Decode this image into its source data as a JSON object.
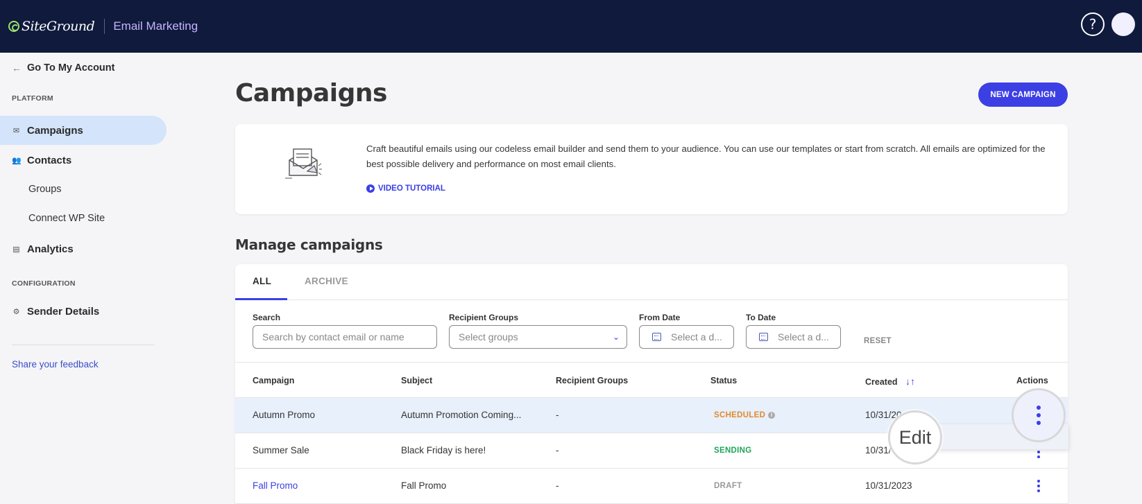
{
  "header": {
    "brand": "SiteGround",
    "product": "Email Marketing",
    "help_glyph": "?"
  },
  "sidebar": {
    "back_label": "Go To My Account",
    "platform_label": "PLATFORM",
    "configuration_label": "CONFIGURATION",
    "items": [
      {
        "label": "Campaigns",
        "icon": "mail-icon",
        "active": true
      },
      {
        "label": "Contacts",
        "icon": "users-icon"
      },
      {
        "label": "Groups"
      },
      {
        "label": "Connect WP Site"
      },
      {
        "label": "Analytics",
        "icon": "chart-icon"
      },
      {
        "label": "Sender Details",
        "icon": "gear-icon"
      }
    ],
    "feedback": "Share your feedback"
  },
  "main": {
    "title": "Campaigns",
    "new_campaign_label": "NEW CAMPAIGN",
    "info_text": "Craft beautiful emails using our codeless email builder and send them to your audience. You can use our templates or start from scratch. All emails are optimized for the best possible delivery and performance on most email clients.",
    "video_tutorial": "VIDEO TUTORIAL",
    "manage_title": "Manage campaigns",
    "tabs": [
      "ALL",
      "ARCHIVE"
    ],
    "filters": {
      "search_label": "Search",
      "search_placeholder": "Search by contact email or name",
      "groups_label": "Recipient Groups",
      "groups_placeholder": "Select groups",
      "from_label": "From Date",
      "from_placeholder": "Select a d...",
      "to_label": "To Date",
      "to_placeholder": "Select a d...",
      "reset_label": "RESET"
    },
    "columns": [
      "Campaign",
      "Subject",
      "Recipient Groups",
      "Status",
      "Created",
      "Actions"
    ],
    "rows": [
      {
        "campaign": "Autumn Promo",
        "subject": "Autumn Promotion Coming...",
        "groups": "-",
        "status": "SCHEDULED",
        "status_color": "#e08a2c",
        "created": "10/31/20"
      },
      {
        "campaign": "Summer Sale",
        "subject": "Black Friday is here!",
        "groups": "-",
        "status": "SENDING",
        "status_color": "#1fa55a",
        "created": "10/31/"
      },
      {
        "campaign": "Fall Promo",
        "subject": "Fall Promo",
        "groups": "-",
        "status": "DRAFT",
        "status_color": "#999999",
        "created": "10/31/2023"
      }
    ],
    "edit_label": "Edit"
  },
  "colors": {
    "header_bg": "#0f1a3c",
    "accent": "#3b3fe4",
    "active_nav_bg": "#d3e4fb"
  }
}
